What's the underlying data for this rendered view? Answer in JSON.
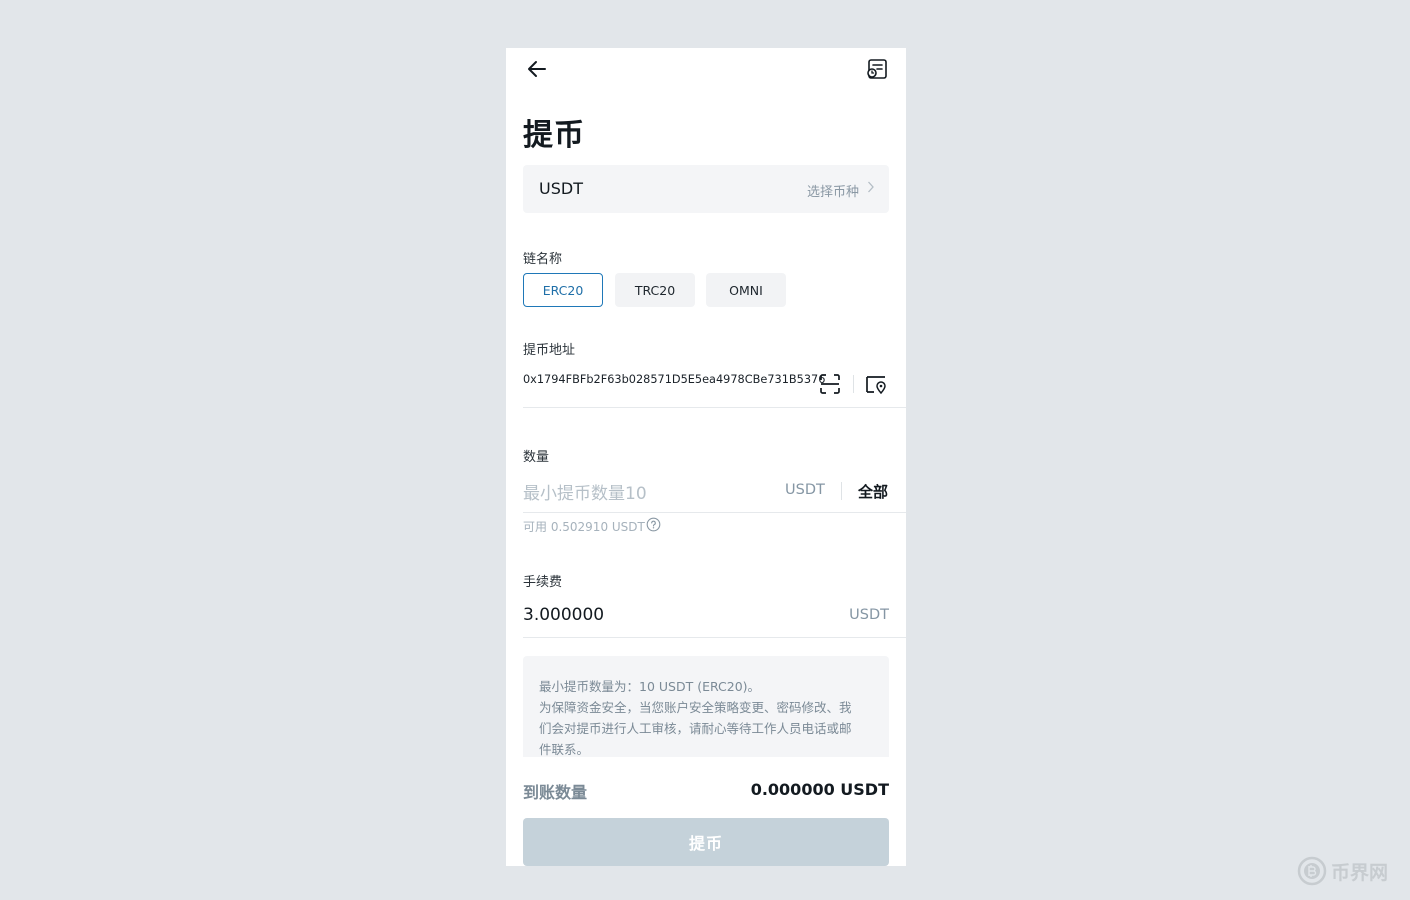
{
  "page": {
    "title": "提币"
  },
  "coin": {
    "name": "USDT",
    "select_hint": "选择币种"
  },
  "chain": {
    "label": "链名称",
    "options": [
      "ERC20",
      "TRC20",
      "OMNI"
    ],
    "selected": "ERC20"
  },
  "address": {
    "label": "提币地址",
    "value": "0x1794FBFb2F63b028571D5E5ea4978CBe731B5376"
  },
  "amount": {
    "label": "数量",
    "placeholder": "最小提币数量10",
    "unit": "USDT",
    "all_label": "全部",
    "available": "可用 0.502910 USDT"
  },
  "fee": {
    "label": "手续费",
    "value": "3.000000",
    "unit": "USDT"
  },
  "notice": {
    "line1": "最小提币数量为：10 USDT (ERC20)。",
    "line2": "为保障资金安全，当您账户安全策略变更、密码修改、我",
    "line3": "们会对提币进行人工审核，请耐心等待工作人员电话或邮",
    "line4": "件联系。"
  },
  "receive": {
    "label": "到账数量",
    "value": "0.000000 USDT"
  },
  "submit": {
    "label": "提币"
  },
  "watermark": {
    "text": "币界网"
  },
  "colors": {
    "background": "#e2e6ea",
    "accent": "#1f78b8",
    "button_disabled": "#c5d2da",
    "muted_text": "#7b8a96"
  }
}
